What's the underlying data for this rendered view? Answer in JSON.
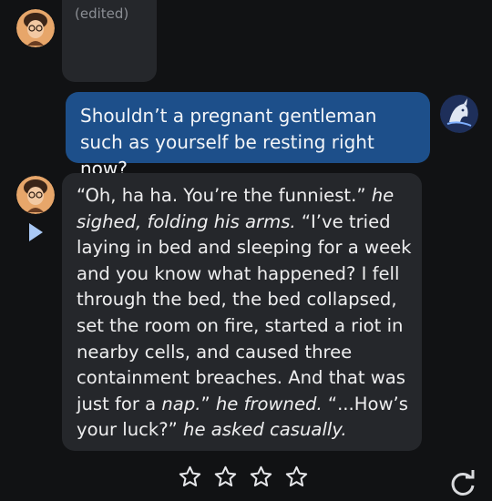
{
  "top_message": {
    "edited_label": "(edited)"
  },
  "user_message": {
    "text": "Shouldn’t a pregnant gentleman such as yourself be resting right now?"
  },
  "bot_message": {
    "segments": [
      {
        "text": "“Oh, ha ha. You’re the funniest.” ",
        "italic": false
      },
      {
        "text": "he sighed, folding his arms.",
        "italic": true
      },
      {
        "text": " “I’ve tried laying in bed and sleeping for a week and you know what happened? I fell through the bed, the bed collapsed, set the room on fire, started a riot in nearby cells, and caused three containment breaches. And that was just for a ",
        "italic": false
      },
      {
        "text": "nap.",
        "italic": true
      },
      {
        "text": "” ",
        "italic": false
      },
      {
        "text": "he frowned.",
        "italic": true
      },
      {
        "text": " “...How’s your luck?” ",
        "italic": false
      },
      {
        "text": "he asked casually.",
        "italic": true
      }
    ]
  },
  "controls": {
    "play_icon": "play-icon",
    "rating_icon": "star-outline-icon",
    "refresh_icon": "refresh-icon",
    "stars": [
      1,
      2,
      3,
      4
    ]
  },
  "colors": {
    "background": "#111214",
    "bot_bubble": "#25272b",
    "user_bubble": "#1d4f8a",
    "accent_play": "#a9c8f5"
  }
}
